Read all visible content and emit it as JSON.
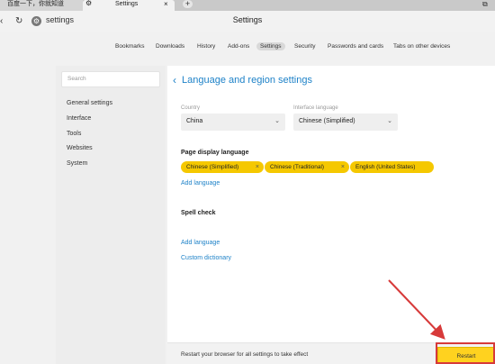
{
  "browser": {
    "tabs": [
      {
        "label": "百度一下，你就知道"
      },
      {
        "label": "Settings",
        "close": "×"
      }
    ],
    "new_tab": "+",
    "address": "settings",
    "page_title": "Settings"
  },
  "settings_tabs": [
    "Bookmarks",
    "Downloads",
    "History",
    "Add-ons",
    "Settings",
    "Security",
    "Passwords and cards",
    "Tabs on other devices"
  ],
  "sidebar": {
    "search_placeholder": "Search",
    "items": [
      "General settings",
      "Interface",
      "Tools",
      "Websites",
      "System"
    ]
  },
  "panel": {
    "title": "Language and region settings",
    "country_label": "Country",
    "country_value": "China",
    "interface_label": "Interface language",
    "interface_value": "Chinese (Simplified)",
    "page_display_heading": "Page display language",
    "languages": [
      "Chinese (Simplified)",
      "Chinese (Traditional)",
      "English (United States)"
    ],
    "add_language_1": "Add language",
    "spell_check_heading": "Spell check",
    "add_language_2": "Add language",
    "custom_dictionary": "Custom dictionary"
  },
  "footer": {
    "message": "Restart your browser for all settings to take effect",
    "restart_label": "Restart"
  },
  "colors": {
    "accent": "#1e82c8",
    "chip": "#f5c800",
    "annotation": "#d73a3a"
  }
}
